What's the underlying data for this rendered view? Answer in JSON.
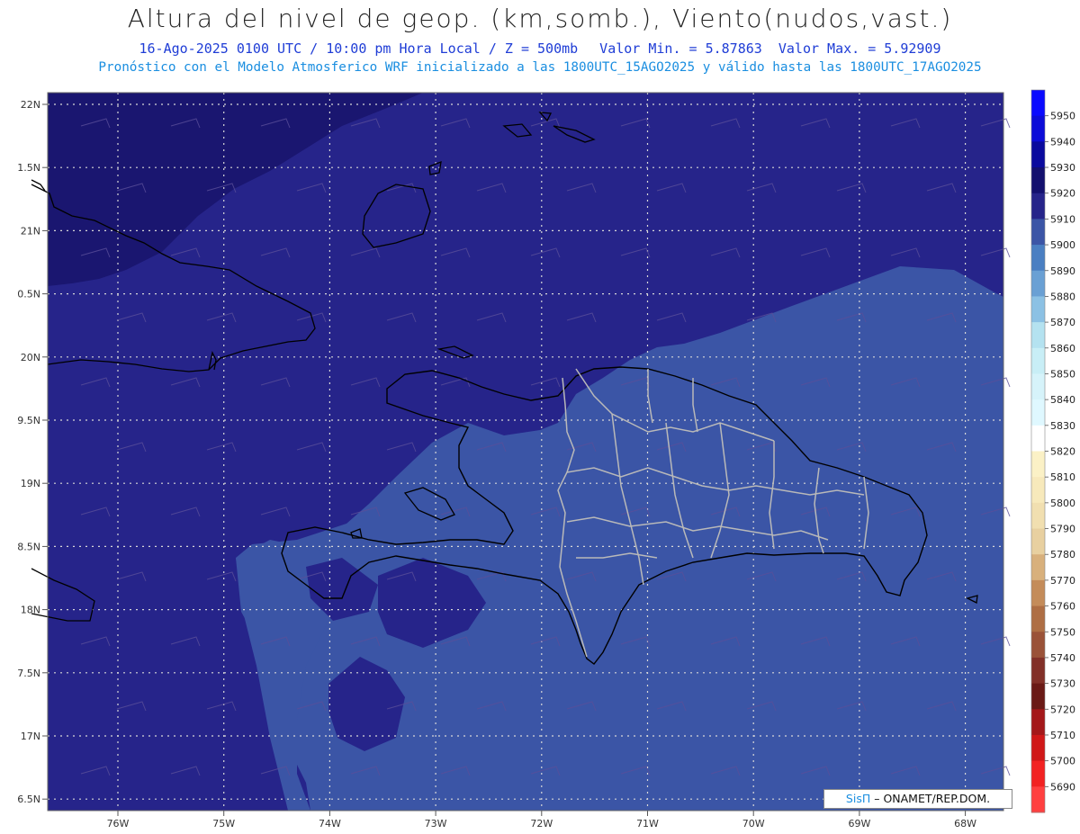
{
  "title": "Altura del nivel de geop. (km,somb.), Viento(nudos,vast.)",
  "subtitle_main": "16-Ago-2025  0100 UTC / 10:00 pm Hora Local / Z = 500mb",
  "subtitle_min": "Valor Min. = 5.87863",
  "subtitle_max": "Valor Max. = 5.92909",
  "forecast_line": "Pronóstico con el Modelo Atmosferico WRF inicializado a las 1800UTC_15AGO2025 y válido hasta las  1800UTC_17AGO2025",
  "credit": {
    "brand": "SisΠ",
    "text": " ONAMET/REP.DOM."
  },
  "lat_labels": [
    "22N",
    "1.5N",
    "21N",
    "0.5N",
    "20N",
    "9.5N",
    "19N",
    "8.5N",
    "18N",
    "7.5N",
    "17N",
    "6.5N"
  ],
  "lon_labels": [
    "76W",
    "75W",
    "74W",
    "73W",
    "72W",
    "71W",
    "70W",
    "69W",
    "68W"
  ],
  "colorbar": {
    "levels": [
      5950,
      5940,
      5930,
      5920,
      5910,
      5900,
      5890,
      5880,
      5870,
      5860,
      5850,
      5840,
      5830,
      5820,
      5810,
      5800,
      5790,
      5780,
      5770,
      5760,
      5750,
      5740,
      5730,
      5720,
      5710,
      5700,
      5690
    ],
    "colors": [
      "#0a0aff",
      "#0c0cd8",
      "#0a0a9e",
      "#13106e",
      "#26248a",
      "#3b55a6",
      "#4a7fc2",
      "#6aa0d4",
      "#8cc1e4",
      "#b4e2f0",
      "#c8eef6",
      "#d6f3fa",
      "#dff8ff",
      "#ffffff",
      "#fbf1c6",
      "#f7e9bb",
      "#f1dfb0",
      "#e8d0a0",
      "#d8b07c",
      "#c48c5a",
      "#ae6e44",
      "#9a5238",
      "#823028",
      "#6a1a16",
      "#a4181a",
      "#d01818",
      "#f22222",
      "#ff4040"
    ]
  },
  "colors": {
    "field_dark": "#26248a",
    "field_mid": "#3b55a6",
    "field_darkest": "#1a1670",
    "coast": "#000000",
    "borders": "#b9b9b9",
    "grid": "#d8d8d8"
  }
}
